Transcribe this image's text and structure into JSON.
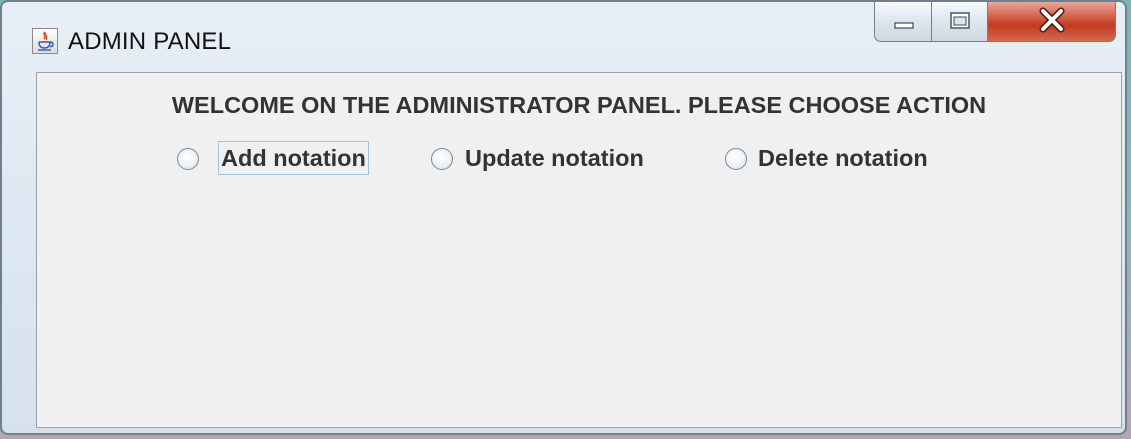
{
  "window": {
    "title": "ADMIN PANEL",
    "icon": "java-icon",
    "controls": {
      "minimize": "minimize-icon",
      "maximize": "maximize-icon",
      "close": "close-icon"
    }
  },
  "panel": {
    "welcome_text": "WELCOME ON THE ADMINISTRATOR PANEL.  PLEASE CHOOSE ACTION",
    "options": [
      {
        "label": "Add notation",
        "selected": false,
        "focused": true
      },
      {
        "label": "Update notation",
        "selected": false,
        "focused": false
      },
      {
        "label": "Delete notation",
        "selected": false,
        "focused": false
      }
    ]
  },
  "colors": {
    "close_button": "#c9452e",
    "panel_background": "#f0f0f0",
    "text": "#333333"
  }
}
